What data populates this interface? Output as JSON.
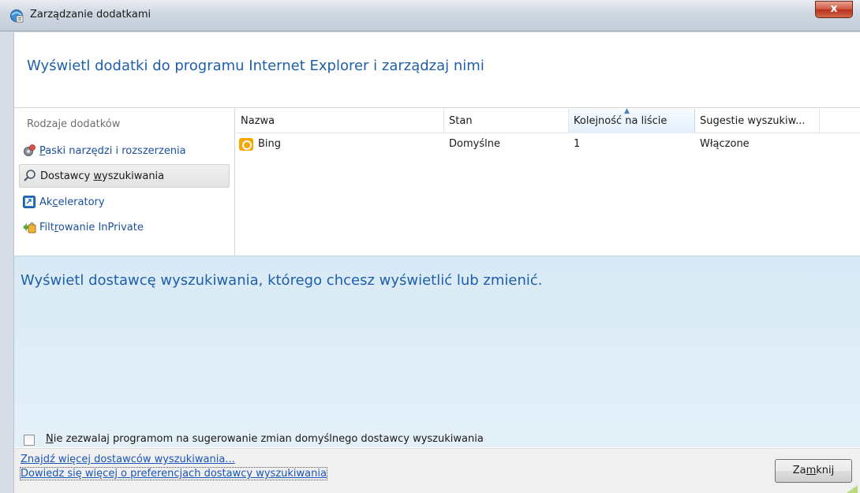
{
  "window": {
    "title": "Zarządzanie dodatkami",
    "close_glyph": "x"
  },
  "header": {
    "text": "Wyświetl dodatki do programu Internet Explorer i zarządzaj nimi"
  },
  "sidebar": {
    "heading": "Rodzaje dodatków",
    "items": [
      {
        "label_pre": "",
        "label_acc": "P",
        "label_post": "aski narzędzi i rozszerzenia",
        "icon": "gear-icon",
        "selected": false
      },
      {
        "label_pre": "Dostawcy ",
        "label_acc": "w",
        "label_post": "yszukiwania",
        "icon": "search-icon",
        "selected": true
      },
      {
        "label_pre": "Ak",
        "label_acc": "c",
        "label_post": "eleratory",
        "icon": "accelerator-icon",
        "selected": false
      },
      {
        "label_pre": "Filt",
        "label_acc": "r",
        "label_post": "owanie InPrivate",
        "icon": "inprivate-icon",
        "selected": false
      }
    ]
  },
  "list": {
    "columns": [
      "Nazwa",
      "Stan",
      "Kolejność na liście",
      "Sugestie wyszukiw..."
    ],
    "sorted_column_index": 2,
    "rows": [
      {
        "name": "Bing",
        "state": "Domyślne",
        "order": "1",
        "suggestions": "Włączone",
        "icon": "bing-icon"
      }
    ]
  },
  "details": {
    "title": "Wyświetl dostawcę wyszukiwania, którego chcesz wyświetlić lub zmienić.",
    "checkbox": {
      "checked": false,
      "label_acc": "N",
      "label_post": "ie zezwalaj programom na sugerowanie zmian domyślnego dostawcy wyszukiwania"
    }
  },
  "footer": {
    "links": [
      "Znajdź więcej dostawców wyszukiwania...",
      "Dowiedz się więcej o preferencjach dostawcy wyszukiwania"
    ],
    "close_button": {
      "pre": "Za",
      "acc": "m",
      "post": "knij"
    }
  },
  "colors": {
    "accent_text": "#1e5fa8",
    "link": "#1a55b8",
    "details_bg": "#d8eaf6",
    "bing": "#f7a600"
  }
}
